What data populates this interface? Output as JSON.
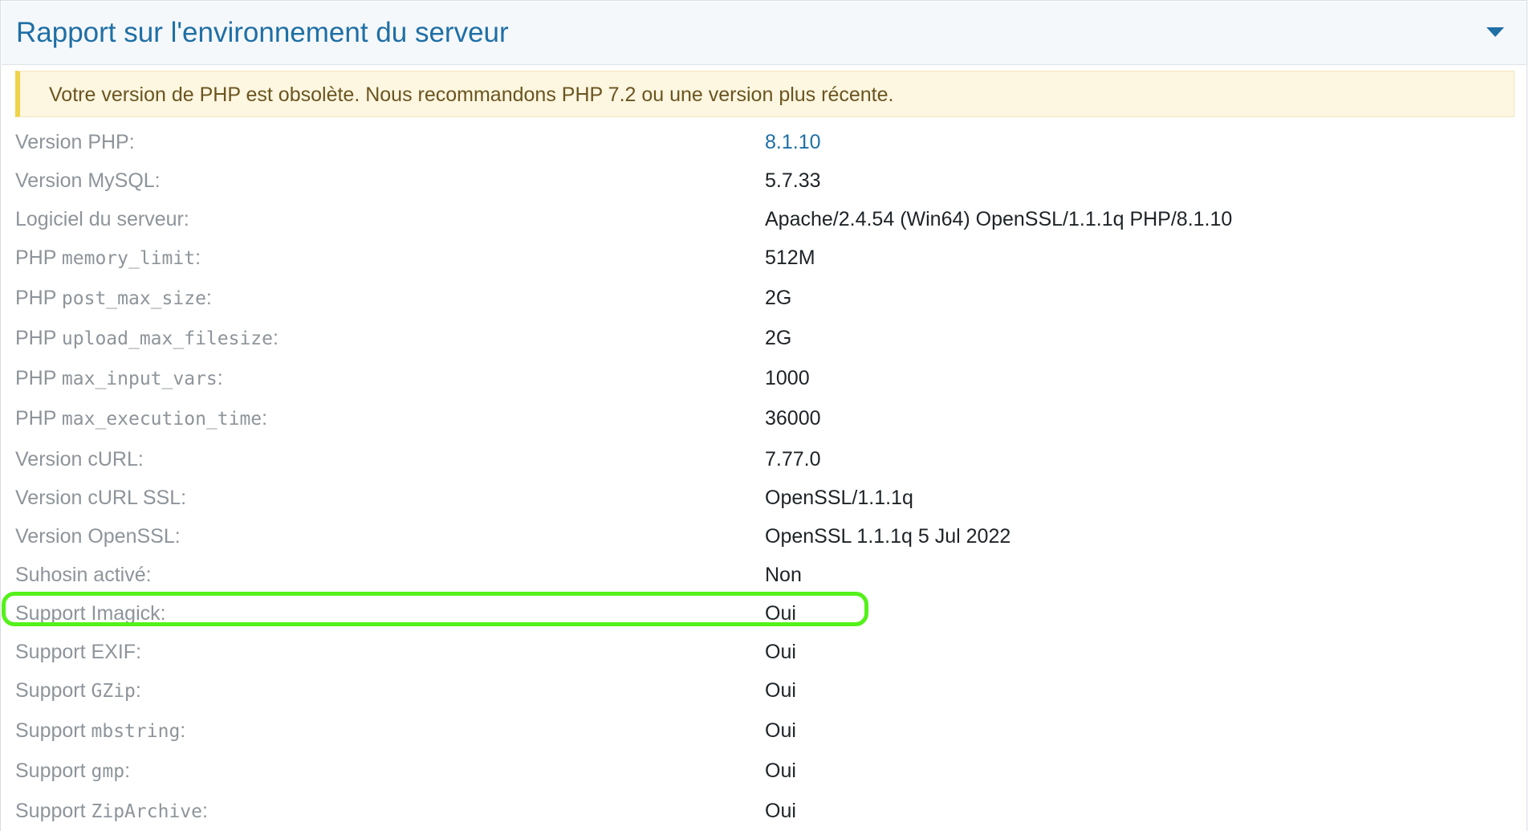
{
  "panel": {
    "title": "Rapport sur l'environnement du serveur",
    "toggle_icon": "caret-down-icon"
  },
  "notice": {
    "text": "Votre version de PHP est obsolète. Nous recommandons PHP 7.2 ou une version plus récente."
  },
  "rows": [
    {
      "label": "Version PHP:",
      "value": "8.1.10"
    },
    {
      "label": "Version MySQL:",
      "value": "5.7.33"
    },
    {
      "label": "Logiciel du serveur:",
      "value": "Apache/2.4.54 (Win64) OpenSSL/1.1.1q PHP/8.1.10"
    },
    {
      "label_prefix": "PHP",
      "label_code": "memory_limit",
      "label_suffix": ":",
      "value": "512M"
    },
    {
      "label_prefix": "PHP",
      "label_code": "post_max_size",
      "label_suffix": ":",
      "value": "2G"
    },
    {
      "label_prefix": "PHP",
      "label_code": "upload_max_filesize",
      "label_suffix": ":",
      "value": "2G"
    },
    {
      "label_prefix": "PHP",
      "label_code": "max_input_vars",
      "label_suffix": ":",
      "value": "1000"
    },
    {
      "label_prefix": "PHP",
      "label_code": "max_execution_time",
      "label_suffix": ":",
      "value": "36000"
    },
    {
      "label": "Version cURL:",
      "value": "7.77.0"
    },
    {
      "label": "Version cURL SSL:",
      "value": "OpenSSL/1.1.1q"
    },
    {
      "label": "Version OpenSSL:",
      "value": "OpenSSL 1.1.1q 5 Jul 2022"
    },
    {
      "label": "Suhosin activé:",
      "value": "Non"
    },
    {
      "label": "Support Imagick:",
      "value": "Oui"
    },
    {
      "label": "Support EXIF:",
      "value": "Oui"
    },
    {
      "label_prefix": "Support",
      "label_code": "GZip",
      "label_suffix": ":",
      "value": "Oui"
    },
    {
      "label_prefix": "Support",
      "label_code": "mbstring",
      "label_suffix": ":",
      "value": "Oui"
    },
    {
      "label_prefix": "Support",
      "label_code": "gmp",
      "label_suffix": ":",
      "value": "Oui"
    },
    {
      "label_prefix": "Support",
      "label_code": "ZipArchive",
      "label_suffix": ":",
      "value": "Oui"
    }
  ],
  "colors": {
    "accent": "#1f6fa5",
    "notice_bg": "#fdf6e0",
    "notice_border": "#f0d24a",
    "highlight_ring": "#54f11a",
    "label": "#8d949a",
    "value": "#1d2327"
  }
}
